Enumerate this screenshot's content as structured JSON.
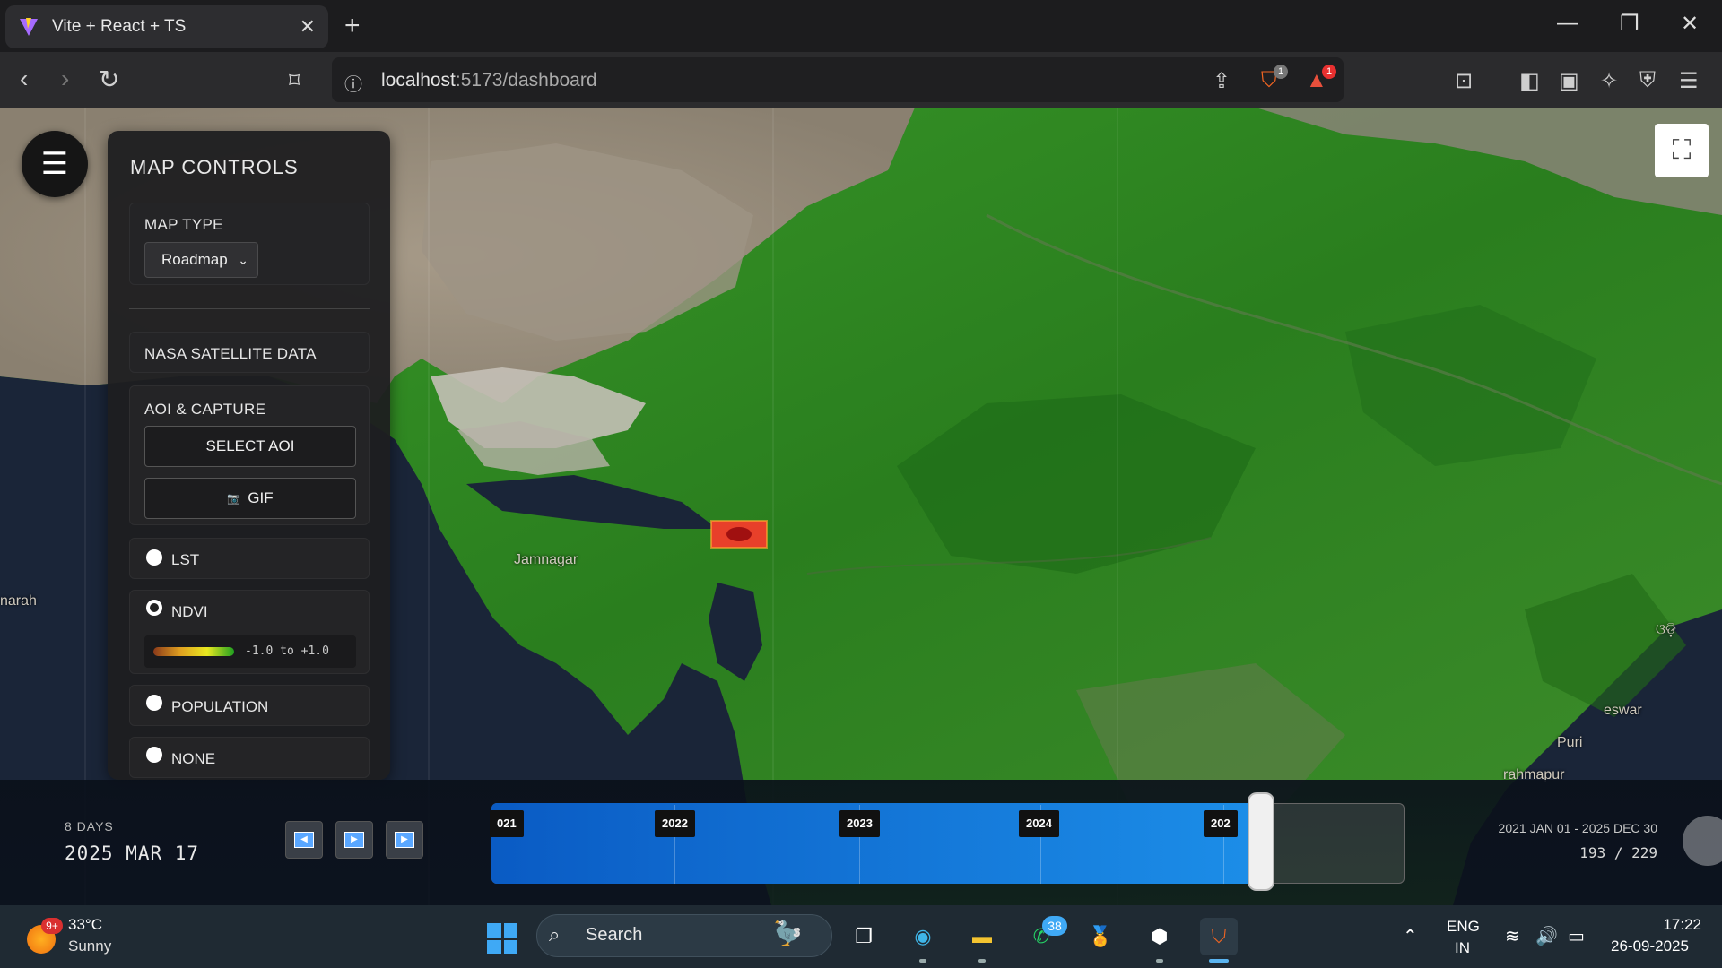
{
  "browser": {
    "tab_title": "Vite + React + TS",
    "url_host": "localhost",
    "url_rest": ":5173/dashboard",
    "shield_badge": "1",
    "alert_badge": "1"
  },
  "map": {
    "labels": {
      "jamnagar": "Jamnagar",
      "left_edge": "narah",
      "right_1": "ଓଡ଼ି",
      "right_2": "eswar",
      "right_3": "Puri",
      "right_4": "rahmapur"
    }
  },
  "panel": {
    "title": "MAP CONTROLS",
    "map_type_label": "MAP TYPE",
    "map_type_value": "Roadmap",
    "nasa_label": "NASA SATELLITE DATA",
    "aoi_label": "AOI & CAPTURE",
    "select_aoi_button": "SELECT AOI",
    "gif_button": "GIF",
    "gif_icon": "📷",
    "layers": [
      {
        "label": "LST",
        "checked": false
      },
      {
        "label": "NDVI",
        "checked": true
      },
      {
        "label": "POPULATION",
        "checked": false
      },
      {
        "label": "NONE",
        "checked": false
      }
    ],
    "ndvi_range": "-1.0 to +1.0"
  },
  "timeline": {
    "interval": "8 DAYS",
    "current_date": "2025 MAR 17",
    "years": [
      "021",
      "2022",
      "2023",
      "2024",
      "202"
    ],
    "range_text": "2021 JAN 01 - 2025 DEC 30",
    "position_text": "193 / 229",
    "position": 193,
    "total": 229
  },
  "taskbar": {
    "weather_badge": "9+",
    "temperature": "33°C",
    "weather": "Sunny",
    "search_label": "Search",
    "whatsapp_badge": "38",
    "lang_line1": "ENG",
    "lang_line2": "IN",
    "time": "17:22",
    "date": "26-09-2025"
  },
  "colors": {
    "timeline_fill": "#1c8ee8",
    "panel_bg": "#1e1e20",
    "vegetation": "#2f8a22"
  }
}
